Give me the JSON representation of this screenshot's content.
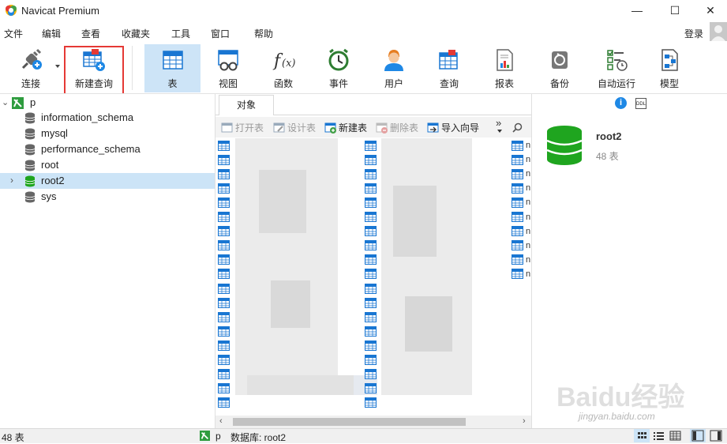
{
  "window": {
    "title": "Navicat Premium",
    "minimize_glyph": "—",
    "maximize_glyph": "☐",
    "close_glyph": "✕"
  },
  "menu": [
    "文件",
    "编辑",
    "查看",
    "收藏夹",
    "工具",
    "窗口",
    "帮助"
  ],
  "login_label": "登录",
  "toolbar": {
    "items": [
      {
        "label": "连接",
        "icon": "plug-icon"
      },
      {
        "label": "新建查询",
        "icon": "new-query-icon"
      },
      {
        "label": "表",
        "icon": "table-icon",
        "active": true
      },
      {
        "label": "视图",
        "icon": "view-icon"
      },
      {
        "label": "函数",
        "icon": "function-icon"
      },
      {
        "label": "事件",
        "icon": "clock-icon"
      },
      {
        "label": "用户",
        "icon": "user-icon"
      },
      {
        "label": "查询",
        "icon": "query-icon"
      },
      {
        "label": "报表",
        "icon": "report-icon"
      },
      {
        "label": "备份",
        "icon": "backup-icon"
      },
      {
        "label": "自动运行",
        "icon": "schedule-icon"
      },
      {
        "label": "模型",
        "icon": "model-icon"
      }
    ]
  },
  "nav": {
    "connection": "p",
    "databases": [
      "information_schema",
      "mysql",
      "performance_schema",
      "root",
      "root2",
      "sys"
    ],
    "selected": "root2"
  },
  "object_tab": "对象",
  "object_toolbar": {
    "open_table": "打开表",
    "design_table": "设计表",
    "new_table": "新建表",
    "delete_table": "删除表",
    "import_wizard": "导入向导",
    "more_glyph": "»"
  },
  "object_list_letter": "n",
  "detail": {
    "db_name": "root2",
    "table_count": "48 表",
    "ddl_label": "DDL"
  },
  "status": {
    "count": "48 表",
    "connection": "p",
    "database": "数据库: root2"
  },
  "watermark": {
    "text": "Baidu经验",
    "sub": "jingyan.baidu.com"
  },
  "colors": {
    "accent_selected": "#cde4f7",
    "annotation_red": "#e53935",
    "db_green": "#1fa51f"
  }
}
